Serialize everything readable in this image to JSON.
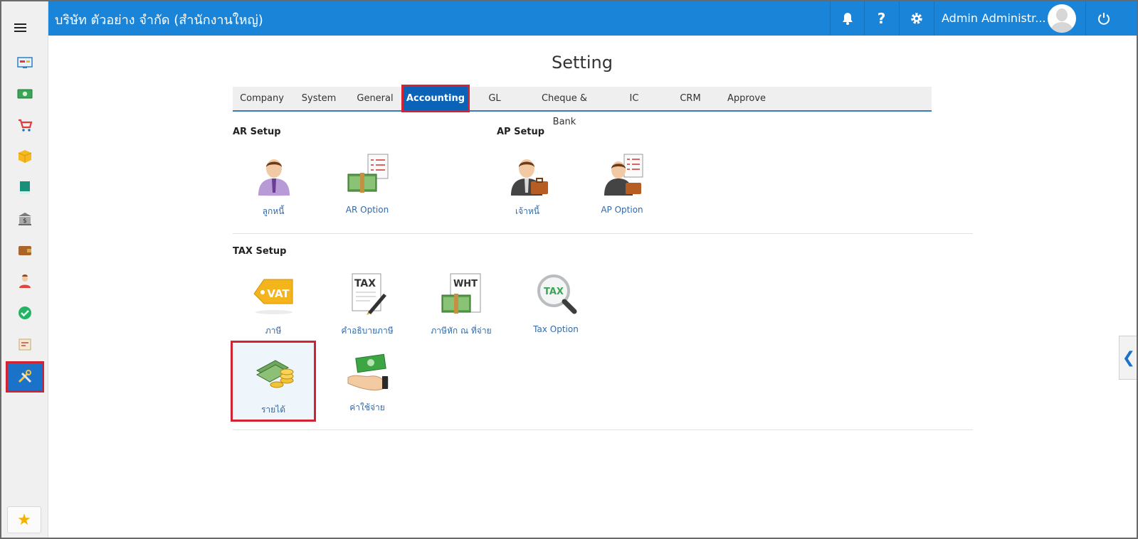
{
  "header": {
    "company": "บริษัท ตัวอย่าง จำกัด (สำนักงานใหญ่)",
    "user_name": "Admin Administr...",
    "icons": [
      "bell-icon",
      "help-icon",
      "gear-icon",
      "avatar",
      "power-icon"
    ]
  },
  "sidebar": {
    "items": [
      "dashboard-icon",
      "cash-icon",
      "cart-icon",
      "box-icon",
      "book-icon",
      "bank-icon",
      "wallet-icon",
      "employee-icon",
      "approve-check-icon",
      "report-icon",
      "tools-icon"
    ],
    "favorite_icon": "star-icon"
  },
  "page": {
    "title": "Setting",
    "tabs": [
      "Company",
      "System",
      "General",
      "Accounting",
      "GL",
      "Cheque & Bank",
      "IC",
      "CRM",
      "Approve"
    ],
    "active_tab": "Accounting"
  },
  "sections": {
    "ar_setup": {
      "title": "AR Setup",
      "items": [
        "ลูกหนี้",
        "AR Option"
      ]
    },
    "ap_setup": {
      "title": "AP Setup",
      "items": [
        "เจ้าหนี้",
        "AP Option"
      ]
    },
    "tax_setup": {
      "title": "TAX Setup",
      "items": [
        "ภาษี",
        "คำอธิบายภาษี",
        "ภาษีหัก ณ ที่จ่าย",
        "Tax Option",
        "รายได้",
        "ค่าใช้จ่าย"
      ]
    }
  },
  "icon_text": {
    "vat": "VAT",
    "tax": "TAX",
    "wht": "WHT",
    "tax_magnifier": "TAX"
  },
  "colors": {
    "topbar": "#1a84d8",
    "active_tab": "#0b63b7",
    "highlight": "#d12332",
    "link": "#336aa8"
  }
}
